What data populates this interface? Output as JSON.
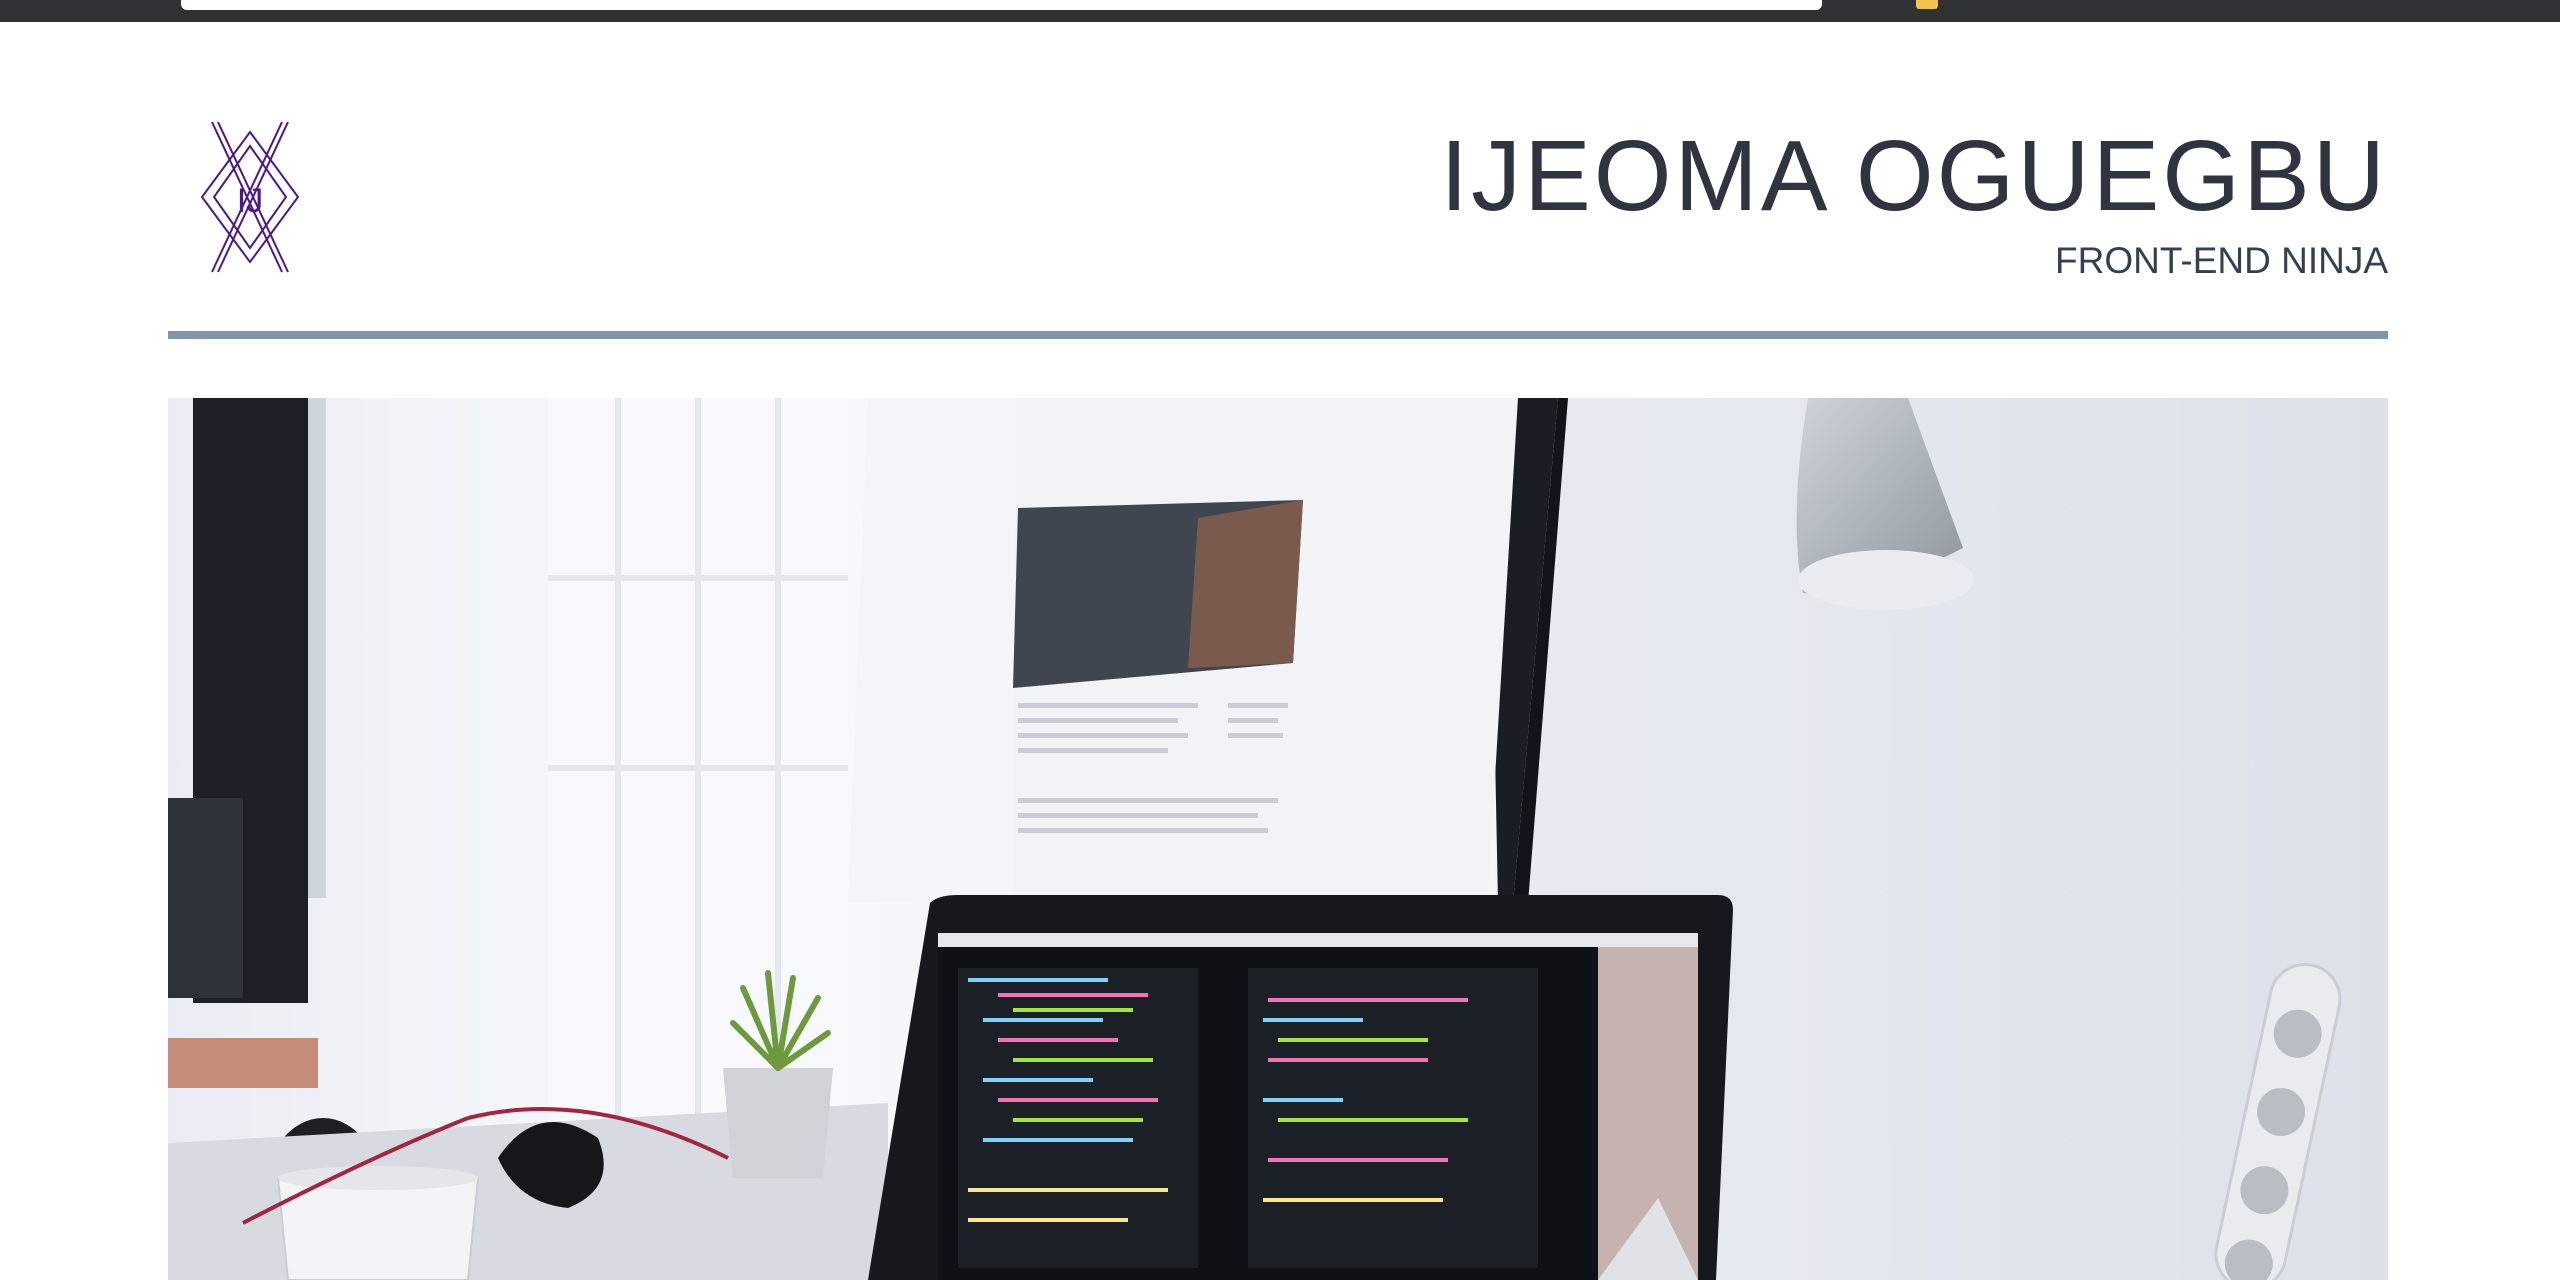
{
  "header": {
    "name": "IJEOMA OGUEGBU",
    "tagline": "FRONT-END NINJA",
    "logo_monogram": "IJ"
  },
  "colors": {
    "topbar": "#2f3133",
    "title": "#2f3440",
    "divider": "#7e95ab",
    "logo": "#4a1a8a"
  },
  "hero": {
    "image": "desk-workspace-photo"
  }
}
